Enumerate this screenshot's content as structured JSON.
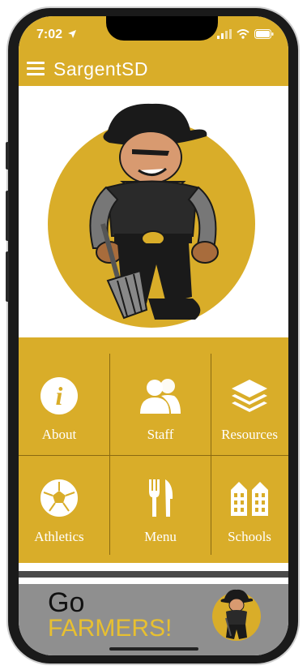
{
  "status_bar": {
    "time": "7:02",
    "icons": [
      "location-arrow-icon",
      "signal-bars-icon",
      "wifi-icon",
      "battery-icon"
    ]
  },
  "app_bar": {
    "title": "SargentSD",
    "menu_icon": "hamburger-menu-icon"
  },
  "hero": {
    "image": "farmer-mascot-logo"
  },
  "tiles": [
    {
      "label": "About",
      "icon": "info-icon"
    },
    {
      "label": "Staff",
      "icon": "people-icon"
    },
    {
      "label": "Resources",
      "icon": "layers-icon"
    },
    {
      "label": "Athletics",
      "icon": "soccer-ball-icon"
    },
    {
      "label": "Menu",
      "icon": "fork-knife-icon"
    },
    {
      "label": "Schools",
      "icon": "buildings-icon"
    }
  ],
  "banner": {
    "line1": "Go",
    "line2": "FARMERS!",
    "image": "farmer-mascot-mini-logo"
  },
  "colors": {
    "accent": "#d9ad29",
    "banner_bg": "#8f8f8f",
    "banner_text_accent": "#e8c030"
  }
}
